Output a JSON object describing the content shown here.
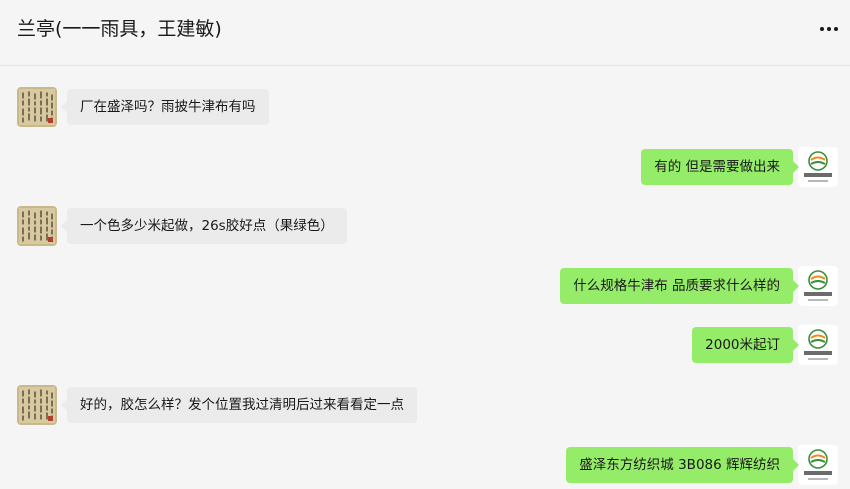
{
  "header": {
    "title": "兰亭(一一雨具，王建敏)",
    "more_icon": "more-dots-icon"
  },
  "colors": {
    "background": "#f5f5f5",
    "incoming_bubble": "#ebebeb",
    "outgoing_bubble": "#95ec69"
  },
  "messages": [
    {
      "side": "left",
      "text": "厂在盛泽吗？雨披牛津布有吗"
    },
    {
      "side": "right",
      "text": "有的 但是需要做出来"
    },
    {
      "side": "left",
      "text": "一个色多少米起做，26s胶好点（果绿色）"
    },
    {
      "side": "right",
      "text": "什么规格牛津布  品质要求什么样的"
    },
    {
      "side": "right",
      "text": "2000米起订"
    },
    {
      "side": "left",
      "text": "好的，胶怎么样？发个位置我过清明后过来看看定一点"
    },
    {
      "side": "right",
      "text": "盛泽东方纺织城  3B086  辉辉纺织"
    }
  ],
  "avatars": {
    "contact": {
      "icon": "calligraphy-avatar-icon"
    },
    "self": {
      "icon": "company-logo-avatar-icon",
      "logo_text": "辉辉纺织"
    }
  }
}
